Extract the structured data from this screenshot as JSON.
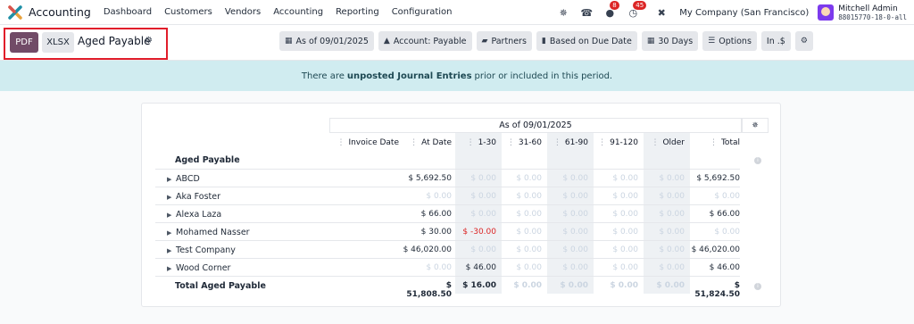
{
  "navbar": {
    "app_name": "Accounting",
    "menu": [
      "Dashboard",
      "Customers",
      "Vendors",
      "Accounting",
      "Reporting",
      "Configuration"
    ],
    "messages_count": "8",
    "activities_count": "45",
    "company": "My Company (San Francisco)",
    "user_name": "Mitchell Admin",
    "database": "88015770-18-0-all"
  },
  "toolbar": {
    "pdf_label": "PDF",
    "xlsx_label": "XLSX",
    "report_title": "Aged Payable",
    "filters": [
      {
        "icon": "calendar-icon",
        "label": "As of 09/01/2025"
      },
      {
        "icon": "user-icon",
        "label": "Account: Payable"
      },
      {
        "icon": "folder-icon",
        "label": "Partners"
      },
      {
        "icon": "document-icon",
        "label": "Based on Due Date"
      },
      {
        "icon": "calendar-icon",
        "label": "30 Days"
      },
      {
        "icon": "sliders-icon",
        "label": "Options"
      },
      {
        "icon": "",
        "label": "In .$"
      },
      {
        "icon": "gears-icon",
        "label": ""
      }
    ]
  },
  "alert": {
    "prefix": "There are",
    "emphasis": "unposted Journal Entries",
    "suffix": "prior or included in this period."
  },
  "report": {
    "period_header": "As of 09/01/2025",
    "columns": [
      "Invoice Date",
      "At Date",
      "1-30",
      "31-60",
      "61-90",
      "91-120",
      "Older",
      "Total"
    ],
    "section_title": "Aged Payable",
    "rows": [
      {
        "partner": "ABCD",
        "values": [
          "",
          "$ 5,692.50",
          "$ 0.00",
          "$ 0.00",
          "$ 0.00",
          "$ 0.00",
          "$ 0.00",
          "$ 5,692.50"
        ]
      },
      {
        "partner": "Aka Foster",
        "values": [
          "",
          "$ 0.00",
          "$ 0.00",
          "$ 0.00",
          "$ 0.00",
          "$ 0.00",
          "$ 0.00",
          "$ 0.00"
        ]
      },
      {
        "partner": "Alexa Laza",
        "values": [
          "",
          "$ 66.00",
          "$ 0.00",
          "$ 0.00",
          "$ 0.00",
          "$ 0.00",
          "$ 0.00",
          "$ 66.00"
        ]
      },
      {
        "partner": "Mohamed Nasser",
        "values": [
          "",
          "$ 30.00",
          "$ -30.00",
          "$ 0.00",
          "$ 0.00",
          "$ 0.00",
          "$ 0.00",
          "$ 0.00"
        ]
      },
      {
        "partner": "Test Company",
        "values": [
          "",
          "$ 46,020.00",
          "$ 0.00",
          "$ 0.00",
          "$ 0.00",
          "$ 0.00",
          "$ 0.00",
          "$ 46,020.00"
        ]
      },
      {
        "partner": "Wood Corner",
        "values": [
          "",
          "$ 0.00",
          "$ 46.00",
          "$ 0.00",
          "$ 0.00",
          "$ 0.00",
          "$ 0.00",
          "$ 46.00"
        ]
      }
    ],
    "total": {
      "label": "Total Aged Payable",
      "values": [
        "",
        "$ 51,808.50",
        "$ 16.00",
        "$ 0.00",
        "$ 0.00",
        "$ 0.00",
        "$ 0.00",
        "$ 51,824.50"
      ]
    }
  },
  "colors": {
    "brand": "#714b67",
    "highlight": "#e11d2a",
    "alert_bg": "#d0ecf0",
    "negative": "#dc2626"
  }
}
